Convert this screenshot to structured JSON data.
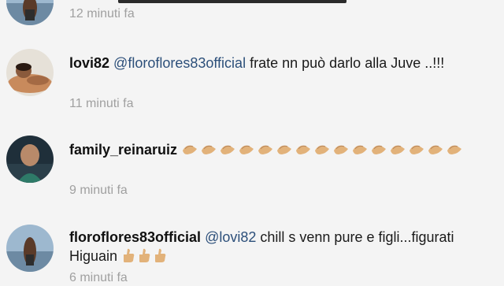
{
  "comments": [
    {
      "username": "",
      "mention": "",
      "text": "",
      "time": "12 minuti fa",
      "emoji_count": 0
    },
    {
      "username": "lovi82",
      "mention": "@floroflores83official",
      "text": "frate nn può darlo alla Juve ..!!!",
      "time": "11 minuti fa",
      "emoji_count": 0
    },
    {
      "username": "family_reinaruiz",
      "mention": "",
      "text": "",
      "time": "9 minuti fa",
      "emoji_count": 15,
      "emoji_name": "clapping-hands-icon"
    },
    {
      "username": "floroflores83official",
      "mention": "@lovi82",
      "text": "chill s venn pure e figli...figurati Higuain",
      "time": "6 minuti fa",
      "emoji_count": 3,
      "emoji_name": "thumbs-up-icon"
    }
  ],
  "colors": {
    "background": "#f4f4f4",
    "username": "#111111",
    "mention": "#2c4f7a",
    "timestamp": "#a0a0a0",
    "emoji": "#e2b27a"
  }
}
